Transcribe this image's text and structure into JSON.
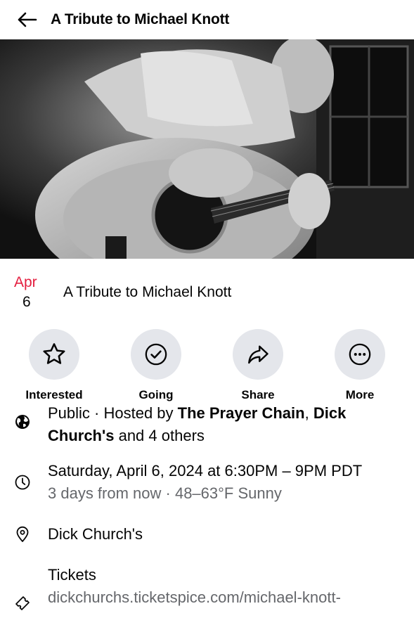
{
  "header": {
    "title": "A Tribute to Michael Knott",
    "back_icon": "arrow-left-icon"
  },
  "cover": {
    "description_icon": "event-cover-photo"
  },
  "date": {
    "month": "Apr",
    "day": "6"
  },
  "event": {
    "name": "A Tribute to Michael Knott"
  },
  "actions": [
    {
      "label": "Interested",
      "icon": "star-icon"
    },
    {
      "label": "Going",
      "icon": "check-circle-icon"
    },
    {
      "label": "Share",
      "icon": "share-arrow-icon"
    },
    {
      "label": "More",
      "icon": "more-dots-icon"
    }
  ],
  "details": {
    "privacy": {
      "prefix": "Public · Hosted by ",
      "host1": "The Prayer Chain",
      "sep": ", ",
      "host2": "Dick Church's",
      "suffix": " and 4 others",
      "icon": "globe-icon"
    },
    "time": {
      "main": "Saturday, April 6, 2024 at 6:30PM – 9PM PDT",
      "sub": "3 days from now · 48–63°F Sunny",
      "icon": "clock-icon"
    },
    "location": {
      "name": "Dick Church's",
      "icon": "map-pin-icon"
    },
    "tickets": {
      "label": "Tickets",
      "url": "dickchurchs.ticketspice.com/michael-knott-",
      "icon": "ticket-icon"
    }
  },
  "colors": {
    "accent_red": "#e41e3f",
    "secondary_text": "#65676b",
    "button_bg": "#e4e6eb"
  }
}
